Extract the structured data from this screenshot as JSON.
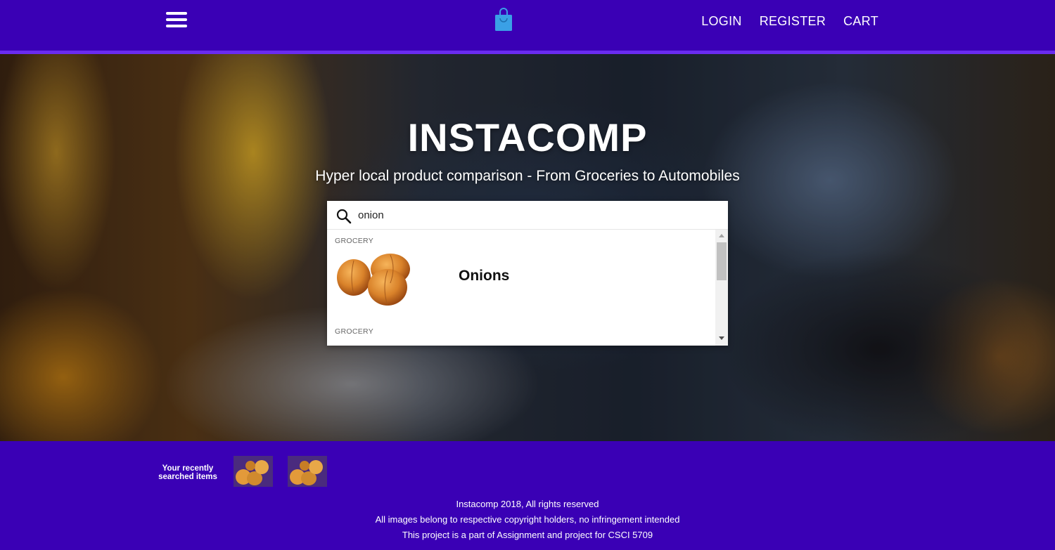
{
  "nav": {
    "menu_icon": "hamburger-menu-icon",
    "logo_icon": "shopping-bag-icon",
    "links": [
      "LOGIN",
      "REGISTER",
      "CART"
    ]
  },
  "hero": {
    "title": "INSTACOMP",
    "subtitle": "Hyper local product comparison - From Groceries to Automobiles"
  },
  "search": {
    "icon": "search-icon",
    "value": "onion",
    "results": [
      {
        "category": "GROCERY",
        "name": "Onions",
        "thumb_icon": "onions-image"
      },
      {
        "category": "GROCERY"
      }
    ]
  },
  "footer": {
    "recent_label": "Your recently searched items",
    "recent_items": [
      "onions-thumbnail",
      "onions-thumbnail"
    ],
    "lines": [
      "Instacomp 2018, All rights reserved",
      "All images belong to respective copyright holders, no infringement intended",
      "This project is a part of Assignment and project for CSCI 5709"
    ]
  },
  "colors": {
    "primary": "#3a00b5",
    "accent_strip": "#6a2bf0",
    "bag_blue": "#3aa0e6"
  }
}
